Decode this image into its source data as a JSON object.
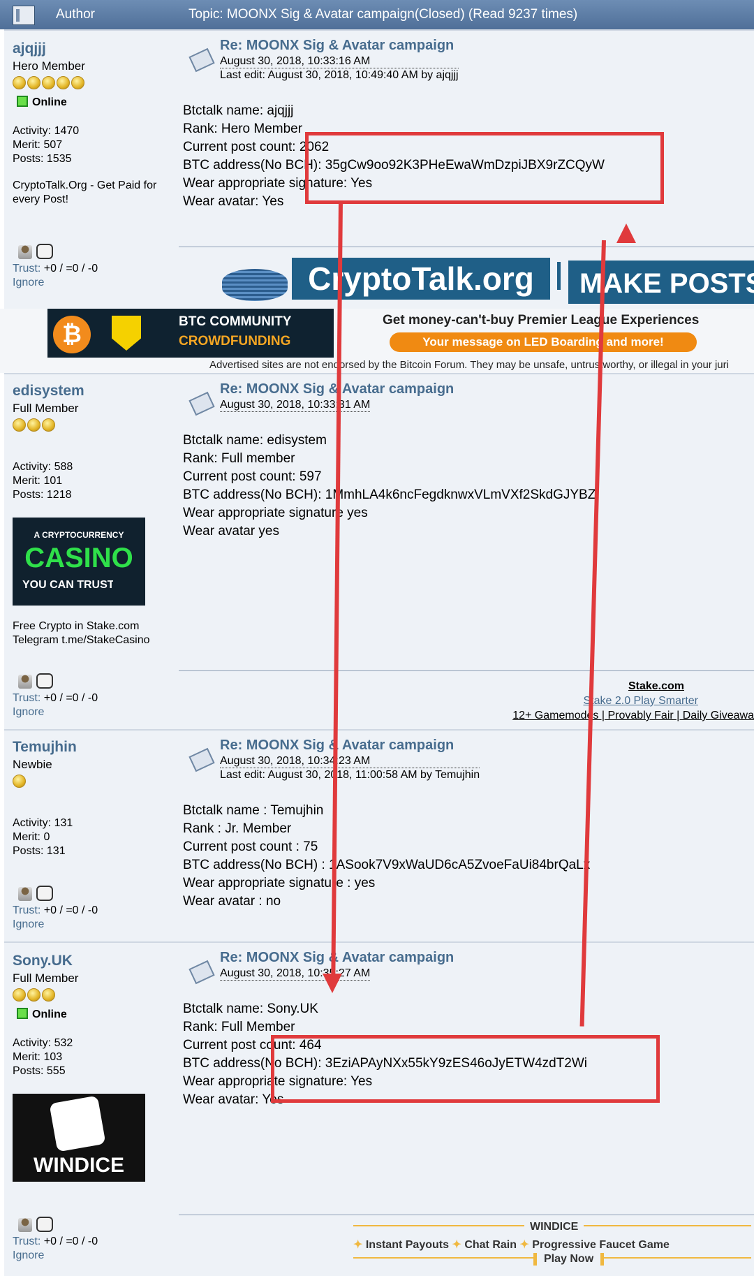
{
  "header": {
    "author": "Author",
    "topic": "Topic: MOONX Sig & Avatar campaign(Closed)  (Read 9237 times)"
  },
  "posts": [
    {
      "user": "ajqjjj",
      "rank": "Hero Member",
      "stars": 5,
      "online": "Online",
      "activity": "Activity: 1470",
      "merit": "Merit: 507",
      "posts": "Posts: 1535",
      "text": "CryptoTalk.Org - Get Paid for every Post!",
      "subject": "Re: MOONX Sig & Avatar campaign",
      "date": "August 30, 2018, 10:33:16 AM",
      "edit": "Last edit: August 30, 2018, 10:49:40 AM by ajqjjj",
      "lines": [
        "Btctalk name: ajqjjj",
        "Rank: Hero Member",
        "Current post count: 2062",
        "BTC address(No BCH): 35gCw9oo92K3PHeEwaWmDzpiJBX9rZCQyW",
        "Wear appropriate signature: Yes",
        "Wear avatar: Yes"
      ],
      "trust": "+0 / =0 / -0"
    },
    {
      "user": "edisystem",
      "rank": "Full Member",
      "stars": 3,
      "activity": "Activity: 588",
      "merit": "Merit: 101",
      "posts": "Posts: 1218",
      "text": "Free Crypto in Stake.com Telegram t.me/StakeCasino",
      "subject": "Re: MOONX Sig & Avatar campaign",
      "date": "August 30, 2018, 10:33:31 AM",
      "lines": [
        "Btctalk name: edisystem",
        "Rank: Full member",
        "Current post count: 597",
        "BTC address(No BCH): 1MmhLA4k6ncFegdknwxVLmVXf2SkdGJYBZ",
        "Wear appropriate signature yes",
        "Wear avatar yes"
      ],
      "trust": "+0 / =0 / -0"
    },
    {
      "user": "Temujhin",
      "rank": "Newbie",
      "stars": 1,
      "activity": "Activity: 131",
      "merit": "Merit: 0",
      "posts": "Posts: 131",
      "subject": "Re: MOONX Sig & Avatar campaign",
      "date": "August 30, 2018, 10:34:23 AM",
      "edit": "Last edit: August 30, 2018, 11:00:58 AM by Temujhin",
      "lines": [
        "Btctalk name : Temujhin",
        "Rank : Jr. Member",
        "Current post count : 75",
        "BTC address(No BCH) : 1ASook7V9xWaUD6cA5ZvoeFaUi84brQaLx",
        "Wear appropriate signature : yes",
        "Wear avatar : no"
      ],
      "trust": "+0 / =0 / -0"
    },
    {
      "user": "Sony.UK",
      "rank": "Full Member",
      "stars": 3,
      "online": "Online",
      "activity": "Activity: 532",
      "merit": "Merit: 103",
      "posts": "Posts: 555",
      "subject": "Re: MOONX Sig & Avatar campaign",
      "date": "August 30, 2018, 10:35:27 AM",
      "lines": [
        "Btctalk name: Sony.UK",
        "Rank: Full Member",
        "Current post count: 464",
        "BTC address(No BCH): 3EziAPAyNXx55kY9zES46oJyETW4zdT2Wi",
        "Wear appropriate signature: Yes",
        "Wear avatar:  Yes"
      ],
      "trust": "+0 / =0 / -0"
    }
  ],
  "common": {
    "trust_label": "Trust:",
    "ignore": "Ignore"
  },
  "sig1": {
    "brand": "CryptoTalk.org",
    "cta": "MAKE POSTS"
  },
  "ad": {
    "btc1": "BTC COMMUNITY",
    "btc2": "CROWDFUNDING",
    "headline": "Get money-can't-buy Premier League Experiences",
    "sub": "Your message on LED Boarding and more!",
    "disclaimer": "Advertised sites are not endorsed by the Bitcoin Forum. They may be unsafe, untrustworthy, or illegal in your juri"
  },
  "sig2": {
    "title": "Stake.com",
    "line2": "Stake 2.0 Play Smarter",
    "line3": "12+ Gamemodes | Provably Fair | Daily Giveawa"
  },
  "sig4": {
    "title": "WINDICE",
    "items": [
      "Instant Payouts",
      "Chat Rain",
      "Progressive Faucet Game"
    ],
    "cta": "Play Now"
  },
  "avatars": {
    "casino1": "A CRYPTOCURRENCY",
    "casino2": "CASINO",
    "casino3": "YOU CAN TRUST",
    "windice": "WINDICE"
  },
  "colors": {
    "header": "#5a7aa3",
    "link": "#476c8e",
    "annotation": "#e03a3c"
  }
}
